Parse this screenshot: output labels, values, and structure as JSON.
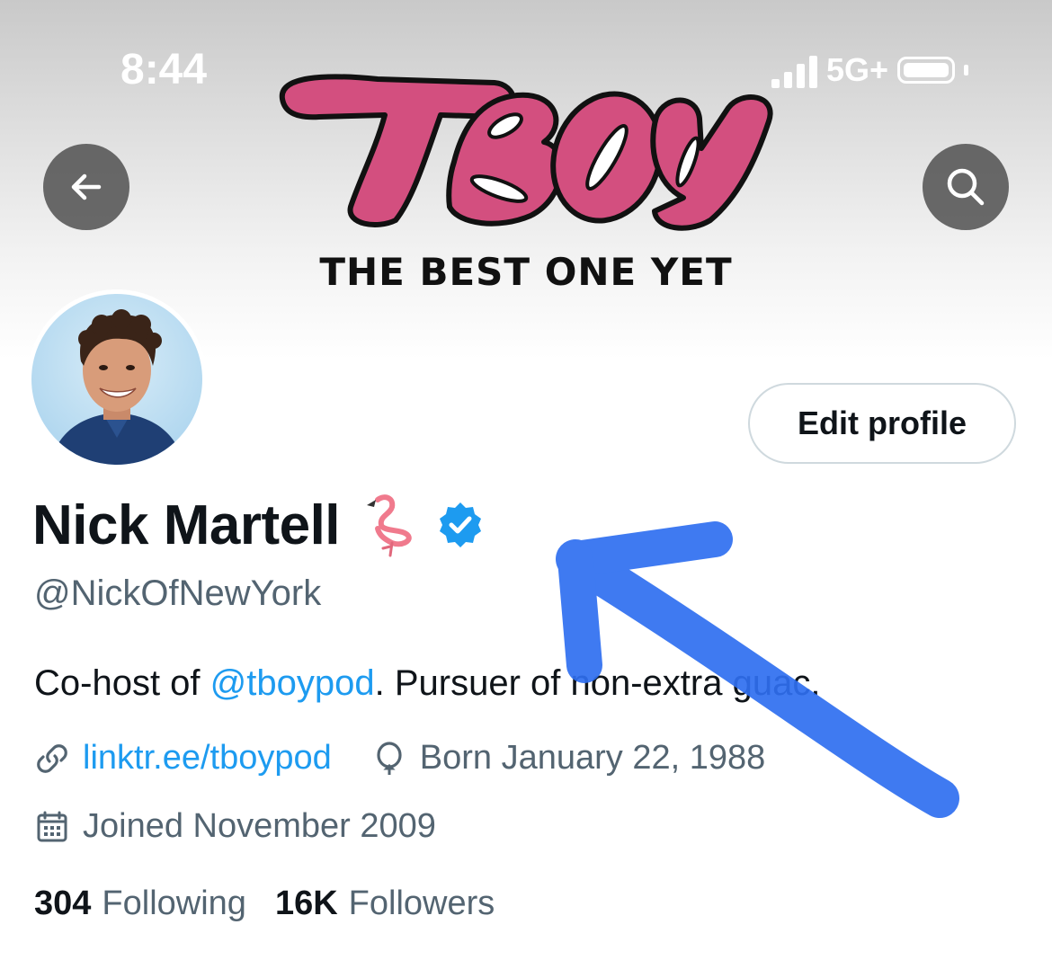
{
  "status_bar": {
    "time": "8:44",
    "network": "5G+"
  },
  "banner": {
    "logo_text": "TBOY",
    "tagline": "THE BEST ONE YET",
    "logo_color": "#d34f7f"
  },
  "nav": {
    "back_icon": "arrow-left-icon",
    "search_icon": "search-icon"
  },
  "profile": {
    "edit_button_label": "Edit profile",
    "display_name": "Nick Martell",
    "name_emoji": "flamingo-icon",
    "verified_badge": "verified-badge-icon",
    "handle": "@NickOfNewYork",
    "bio": {
      "prefix": "Co-host of ",
      "mention": "@tboypod",
      "suffix": ". Pursuer of non-extra guac."
    },
    "link": "linktr.ee/tboypod",
    "birthday": "Born January 22, 1988",
    "joined": "Joined November 2009",
    "following_count": "304",
    "following_label": "Following",
    "followers_count": "16K",
    "followers_label": "Followers"
  },
  "colors": {
    "accent": "#1d9bf0",
    "secondary_text": "#536471",
    "annotation_arrow": "#2f6ff0"
  }
}
